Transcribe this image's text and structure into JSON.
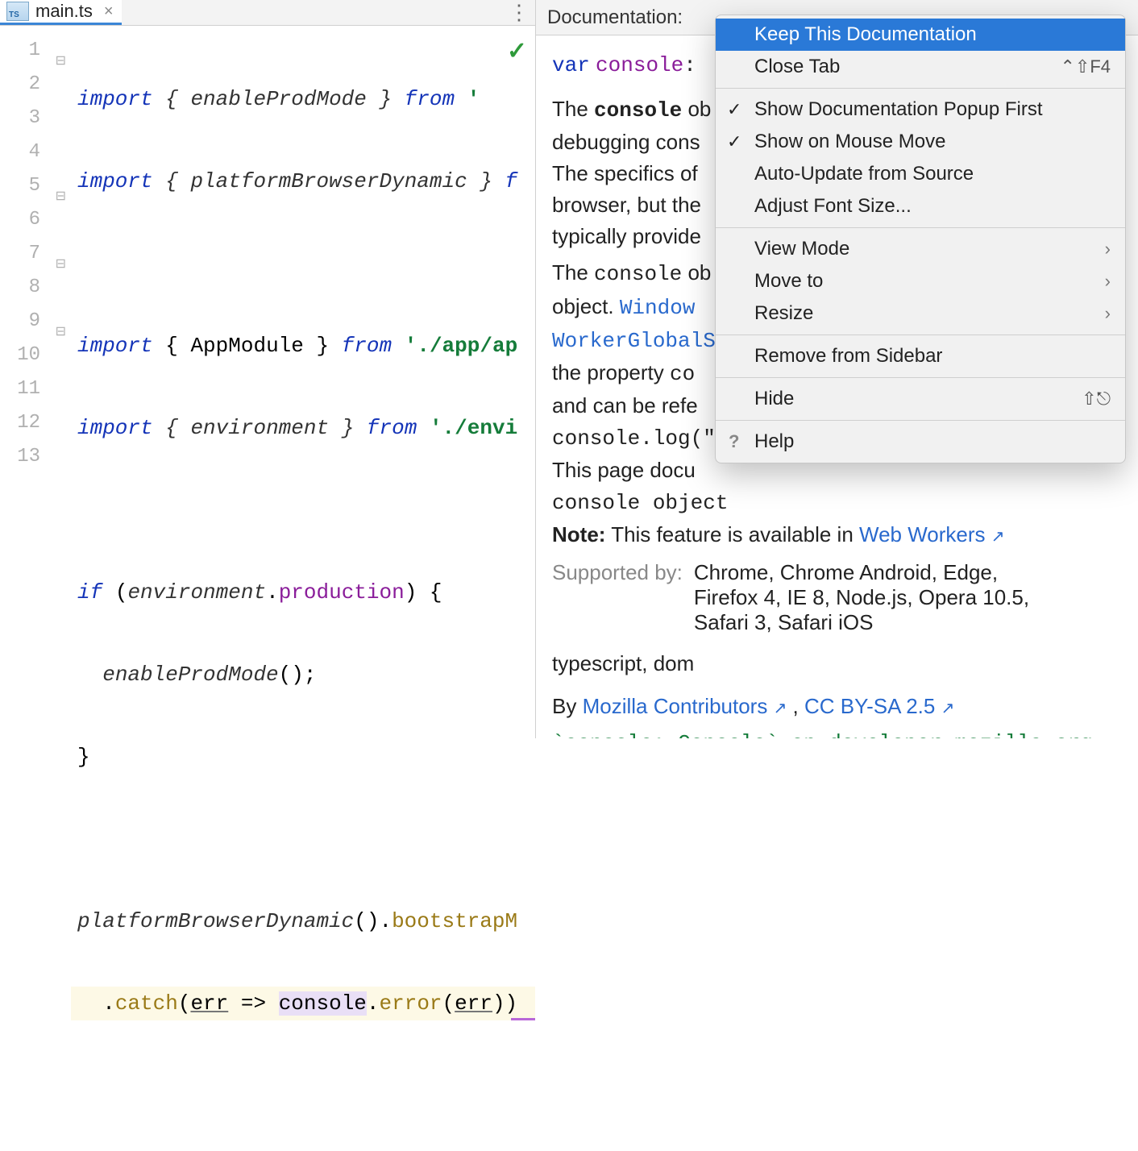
{
  "tab": {
    "filename": "main.ts",
    "icon_badge": "TS"
  },
  "gutter": {
    "lines": [
      "1",
      "2",
      "3",
      "4",
      "5",
      "6",
      "7",
      "8",
      "9",
      "10",
      "11",
      "12",
      "13"
    ]
  },
  "code": {
    "l1": {
      "kw": "import",
      "lb": "{ ",
      "id": "enableProdMode",
      "rb": " }",
      "from": "from",
      "str": "'"
    },
    "l2": {
      "kw": "import",
      "lb": "{ ",
      "id": "platformBrowserDynamic",
      "rb": " }",
      "from": "f"
    },
    "l4": {
      "kw": "import",
      "lb": "{ ",
      "id": "AppModule",
      "rb": " }",
      "from": "from",
      "str": "'./app/ap"
    },
    "l5": {
      "kw": "import",
      "lb": "{ ",
      "id": "environment",
      "rb": " }",
      "from": "from",
      "str": "'./envi"
    },
    "l7": {
      "kw": "if",
      "open": "(",
      "id": "environment",
      "dot": ".",
      "field": "production",
      "close": ") {"
    },
    "l8": {
      "call": "enableProdMode",
      "tail": "();"
    },
    "l9": {
      "brace": "}"
    },
    "l11": {
      "id": "platformBrowserDynamic",
      "call": "().",
      "fn": "bootstrapM"
    },
    "l12": {
      "pre": ".",
      "fn": "catch",
      "open": "(",
      "err1": "err",
      "arrow": " => ",
      "console": "console",
      "dot": ".",
      "errfn": "error",
      "open2": "(",
      "err2": "err",
      "close": "))"
    }
  },
  "doc": {
    "header": "Documentation:",
    "sig": {
      "kw": "var",
      "name": "console",
      "colon": ":"
    },
    "p1a": "The ",
    "p1b": "console",
    "p1c": " ob",
    "p2": "debugging cons",
    "p3": "The specifics of",
    "p4": "browser, but the",
    "p5": "typically provide",
    "p6a": "The ",
    "p6b": "console",
    "p6c": " ob",
    "p7a": "object. ",
    "p7link": "Window",
    "p8link": "WorkerGlobalS",
    "p9a": "the property ",
    "p9b": "co",
    "p10": "and can be refe",
    "p11": "console.log(\"",
    "p12": "This page docu",
    "p13": "console object",
    "note_label": "Note:",
    "note_text": " This feature is available in ",
    "note_link": "Web Workers",
    "support_label": "Supported by:",
    "support_text": "Chrome, Chrome Android, Edge, Firefox 4, IE 8, Node.js, Opera 10.5, Safari 3, Safari iOS",
    "meta": "typescript, dom",
    "by_prefix": "By ",
    "by_link1": "Mozilla Contributors",
    "by_sep": " , ",
    "by_link2": "CC BY-SA 2.5",
    "bottom_code": "`console: Console` on developer mozilla org"
  },
  "menu": {
    "keep": "Keep This Documentation",
    "close_tab": "Close Tab",
    "close_shortcut": "⌃⇧F4",
    "show_popup": "Show Documentation Popup First",
    "show_mouse": "Show on Mouse Move",
    "auto_update": "Auto-Update from Source",
    "adjust_font": "Adjust Font Size...",
    "view_mode": "View Mode",
    "move_to": "Move to",
    "resize": "Resize",
    "remove_sidebar": "Remove from Sidebar",
    "hide": "Hide",
    "hide_shortcut": "⇧⎋",
    "help": "Help"
  }
}
